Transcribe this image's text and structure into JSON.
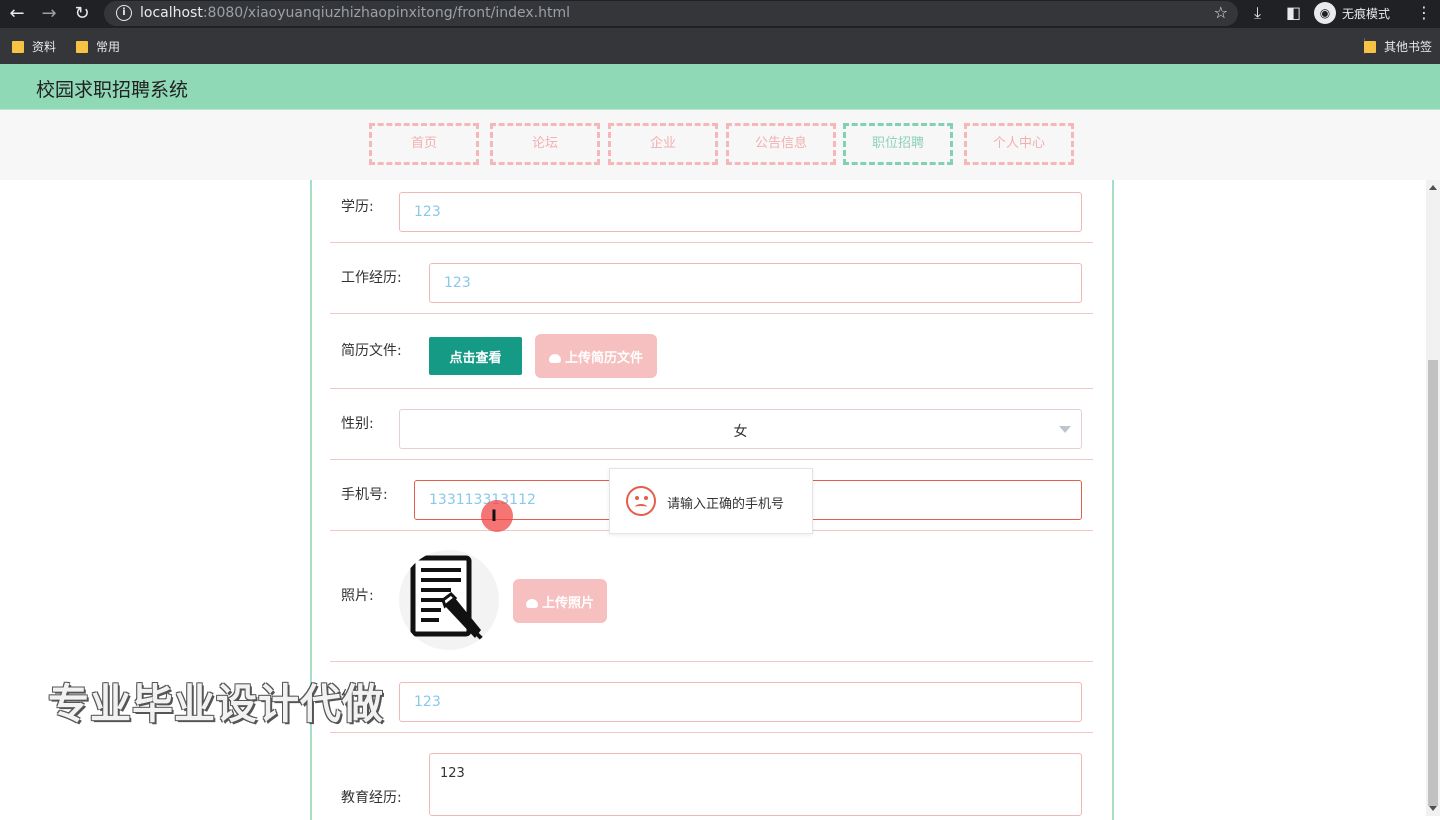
{
  "browser": {
    "url_host": "localhost",
    "url_path": ":8080/xiaoyuanqiuzhizhaopinxitong/front/index.html",
    "profile_label": "无痕模式",
    "bookmarks": [
      "资料",
      "常用"
    ],
    "other_bookmarks": "其他书签"
  },
  "app": {
    "title": "校园求职招聘系统",
    "nav": [
      "首页",
      "论坛",
      "企业",
      "公告信息",
      "职位招聘",
      "个人中心"
    ],
    "active_nav": "职位招聘"
  },
  "form": {
    "education_label": "学历:",
    "education_value": "123",
    "work_label": "工作经历:",
    "work_value": "123",
    "resume_label": "简历文件:",
    "view_button": "点击查看",
    "upload_resume_button": "上传简历文件",
    "gender_label": "性别:",
    "gender_value": "女",
    "phone_label": "手机号:",
    "phone_value": "133113313112",
    "photo_label": "照片:",
    "upload_photo_button": "上传照片",
    "position_label": "位置:",
    "position_value": "123",
    "edu_exp_label": "教育经历:",
    "edu_exp_value": "123"
  },
  "tooltip": {
    "message": "请输入正确的手机号"
  },
  "watermark": "专业毕业设计代做",
  "colors": {
    "header_bg": "#90d9b7",
    "nav_border": "#f5b7b7",
    "nav_active": "#7fd3b0",
    "primary_button": "#159a86",
    "upload_button": "#f6c0c0",
    "error": "#e45d47"
  }
}
